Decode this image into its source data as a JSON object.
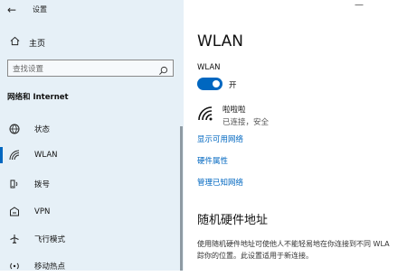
{
  "window": {
    "title": "设置"
  },
  "sidebar": {
    "home_label": "主页",
    "search_placeholder": "查找设置",
    "section_title": "网络和 Internet",
    "items": [
      {
        "label": "状态",
        "icon": "globe-icon"
      },
      {
        "label": "WLAN",
        "icon": "wifi-icon",
        "active": true
      },
      {
        "label": "拨号",
        "icon": "phone-icon"
      },
      {
        "label": "VPN",
        "icon": "vpn-icon"
      },
      {
        "label": "飞行模式",
        "icon": "airplane-icon"
      },
      {
        "label": "移动热点",
        "icon": "hotspot-icon"
      }
    ]
  },
  "main": {
    "title": "WLAN",
    "wlan_label": "WLAN",
    "toggle_state": "开",
    "network": {
      "name": "啦啦啦",
      "status": "已连接，安全"
    },
    "links": [
      "显示可用网络",
      "硬件属性",
      "管理已知网络"
    ],
    "random_hw": {
      "title": "随机硬件地址",
      "desc_line1": "使用随机硬件地址可使他人不能轻易地在你连接到不同 WLA",
      "desc_line2": "踪你的位置。此设置适用于新连接。"
    }
  },
  "colors": {
    "accent": "#0067c0",
    "sidebar_bg": "#e6f0f7"
  }
}
